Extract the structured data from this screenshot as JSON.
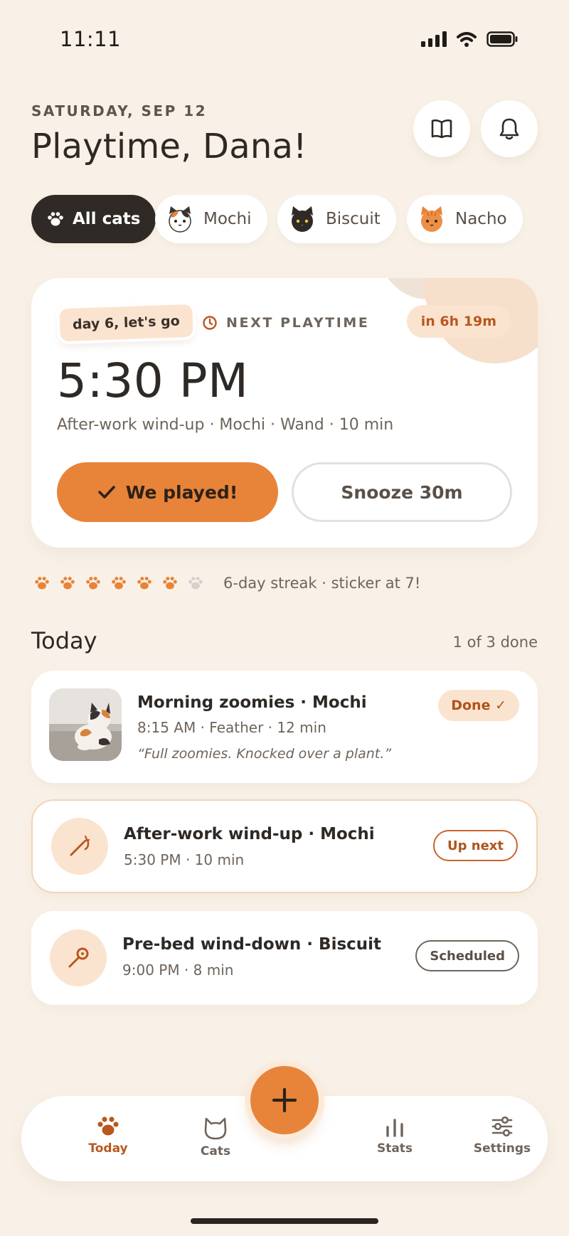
{
  "status_bar": {
    "time": "11:11"
  },
  "header": {
    "date": "SATURDAY, SEP 12",
    "title": "Playtime, Dana!",
    "icons": [
      "book-icon",
      "bell-icon"
    ]
  },
  "filters": {
    "all_label": "All cats",
    "cats": [
      {
        "name": "Mochi",
        "icon": "calico-cat-face"
      },
      {
        "name": "Biscuit",
        "icon": "black-cat-face"
      },
      {
        "name": "Nacho",
        "icon": "orange-cat-face"
      }
    ]
  },
  "next_card": {
    "sticker": "day 6, let's go",
    "label": "NEXT PLAYTIME",
    "countdown": "in 6h 19m",
    "time": "5:30 PM",
    "subtitle": "After-work wind-up · Mochi · Wand · 10 min",
    "primary_button": "We played!",
    "secondary_button": "Snooze 30m"
  },
  "streak": {
    "filled": 6,
    "total": 7,
    "text": "6-day streak · sticker at 7!",
    "colors": {
      "filled": "#E7843A",
      "empty": "#D6D0CA"
    }
  },
  "today": {
    "title": "Today",
    "count": "1 of 3 done",
    "sessions": [
      {
        "title": "Morning zoomies · Mochi",
        "subtitle": "8:15 AM · Feather · 12 min",
        "note": "“Full zoomies. Knocked over a plant.”",
        "badge": "Done ✓"
      },
      {
        "title": "After-work wind-up · Mochi",
        "subtitle": "5:30 PM · 10 min",
        "badge": "Up next",
        "icon": "wand-icon"
      },
      {
        "title": "Pre-bed wind-down · Biscuit",
        "subtitle": "9:00 PM · 8 min",
        "badge": "Scheduled",
        "icon": "toy-wand-icon"
      }
    ]
  },
  "nav": {
    "items": [
      {
        "label": "Today",
        "icon": "paw-icon",
        "active": true
      },
      {
        "label": "Cats",
        "icon": "cat-icon"
      },
      {
        "label": "Stats",
        "icon": "bar-chart-icon"
      },
      {
        "label": "Settings",
        "icon": "sliders-icon"
      }
    ],
    "fab_icon": "plus-icon"
  },
  "colors": {
    "accent": "#E7843A",
    "background": "#F9F1E7",
    "dark": "#2F2A26",
    "badge_bg": "#FBE4CF"
  }
}
